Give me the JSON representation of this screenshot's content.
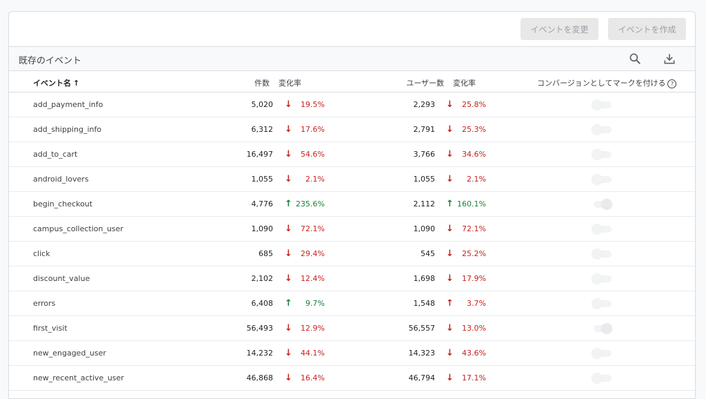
{
  "toolbar": {
    "modify_label": "イベントを変更",
    "create_label": "イベントを作成"
  },
  "section": {
    "title": "既存のイベント"
  },
  "columns": {
    "name": "イベント名",
    "sort_arrow": "↑",
    "count": "件数",
    "change": "変化率",
    "users": "ユーザー数",
    "change2": "変化率",
    "conversion": "コンバージョンとしてマークを付ける",
    "help": "?"
  },
  "rows": [
    {
      "name": "add_payment_info",
      "count": "5,020",
      "count_dir": "down",
      "count_arrow": "↓",
      "count_pct": "19.5%",
      "users": "2,293",
      "users_dir": "down",
      "users_arrow": "↓",
      "users_pct": "25.8%",
      "conversion": false
    },
    {
      "name": "add_shipping_info",
      "count": "6,312",
      "count_dir": "down",
      "count_arrow": "↓",
      "count_pct": "17.6%",
      "users": "2,791",
      "users_dir": "down",
      "users_arrow": "↓",
      "users_pct": "25.3%",
      "conversion": false
    },
    {
      "name": "add_to_cart",
      "count": "16,497",
      "count_dir": "down",
      "count_arrow": "↓",
      "count_pct": "54.6%",
      "users": "3,766",
      "users_dir": "down",
      "users_arrow": "↓",
      "users_pct": "34.6%",
      "conversion": false
    },
    {
      "name": "android_lovers",
      "count": "1,055",
      "count_dir": "down",
      "count_arrow": "↓",
      "count_pct": "2.1%",
      "users": "1,055",
      "users_dir": "down",
      "users_arrow": "↓",
      "users_pct": "2.1%",
      "conversion": false
    },
    {
      "name": "begin_checkout",
      "count": "4,776",
      "count_dir": "up",
      "count_arrow": "↑",
      "count_pct": "235.6%",
      "users": "2,112",
      "users_dir": "up",
      "users_arrow": "↑",
      "users_pct": "160.1%",
      "conversion": true
    },
    {
      "name": "campus_collection_user",
      "count": "1,090",
      "count_dir": "down",
      "count_arrow": "↓",
      "count_pct": "72.1%",
      "users": "1,090",
      "users_dir": "down",
      "users_arrow": "↓",
      "users_pct": "72.1%",
      "conversion": false
    },
    {
      "name": "click",
      "count": "685",
      "count_dir": "down",
      "count_arrow": "↓",
      "count_pct": "29.4%",
      "users": "545",
      "users_dir": "down",
      "users_arrow": "↓",
      "users_pct": "25.2%",
      "conversion": false
    },
    {
      "name": "discount_value",
      "count": "2,102",
      "count_dir": "down",
      "count_arrow": "↓",
      "count_pct": "12.4%",
      "users": "1,698",
      "users_dir": "down",
      "users_arrow": "↓",
      "users_pct": "17.9%",
      "conversion": false
    },
    {
      "name": "errors",
      "count": "6,408",
      "count_dir": "up",
      "count_arrow": "↑",
      "count_pct": "9.7%",
      "users": "1,548",
      "users_dir": "down",
      "users_arrow": "↑",
      "users_pct": "3.7%",
      "conversion": false
    },
    {
      "name": "first_visit",
      "count": "56,493",
      "count_dir": "down",
      "count_arrow": "↓",
      "count_pct": "12.9%",
      "users": "56,557",
      "users_dir": "down",
      "users_arrow": "↓",
      "users_pct": "13.0%",
      "conversion": true
    },
    {
      "name": "new_engaged_user",
      "count": "14,232",
      "count_dir": "down",
      "count_arrow": "↓",
      "count_pct": "44.1%",
      "users": "14,323",
      "users_dir": "down",
      "users_arrow": "↓",
      "users_pct": "43.6%",
      "conversion": false
    },
    {
      "name": "new_recent_active_user",
      "count": "46,868",
      "count_dir": "down",
      "count_arrow": "↓",
      "count_pct": "16.4%",
      "users": "46,794",
      "users_dir": "down",
      "users_arrow": "↓",
      "users_pct": "17.1%",
      "conversion": false
    }
  ],
  "colors": {
    "down": "#c5221f",
    "up": "#188038",
    "border": "#dadce0"
  },
  "icons": {
    "search": "search-icon",
    "download": "download-icon"
  }
}
